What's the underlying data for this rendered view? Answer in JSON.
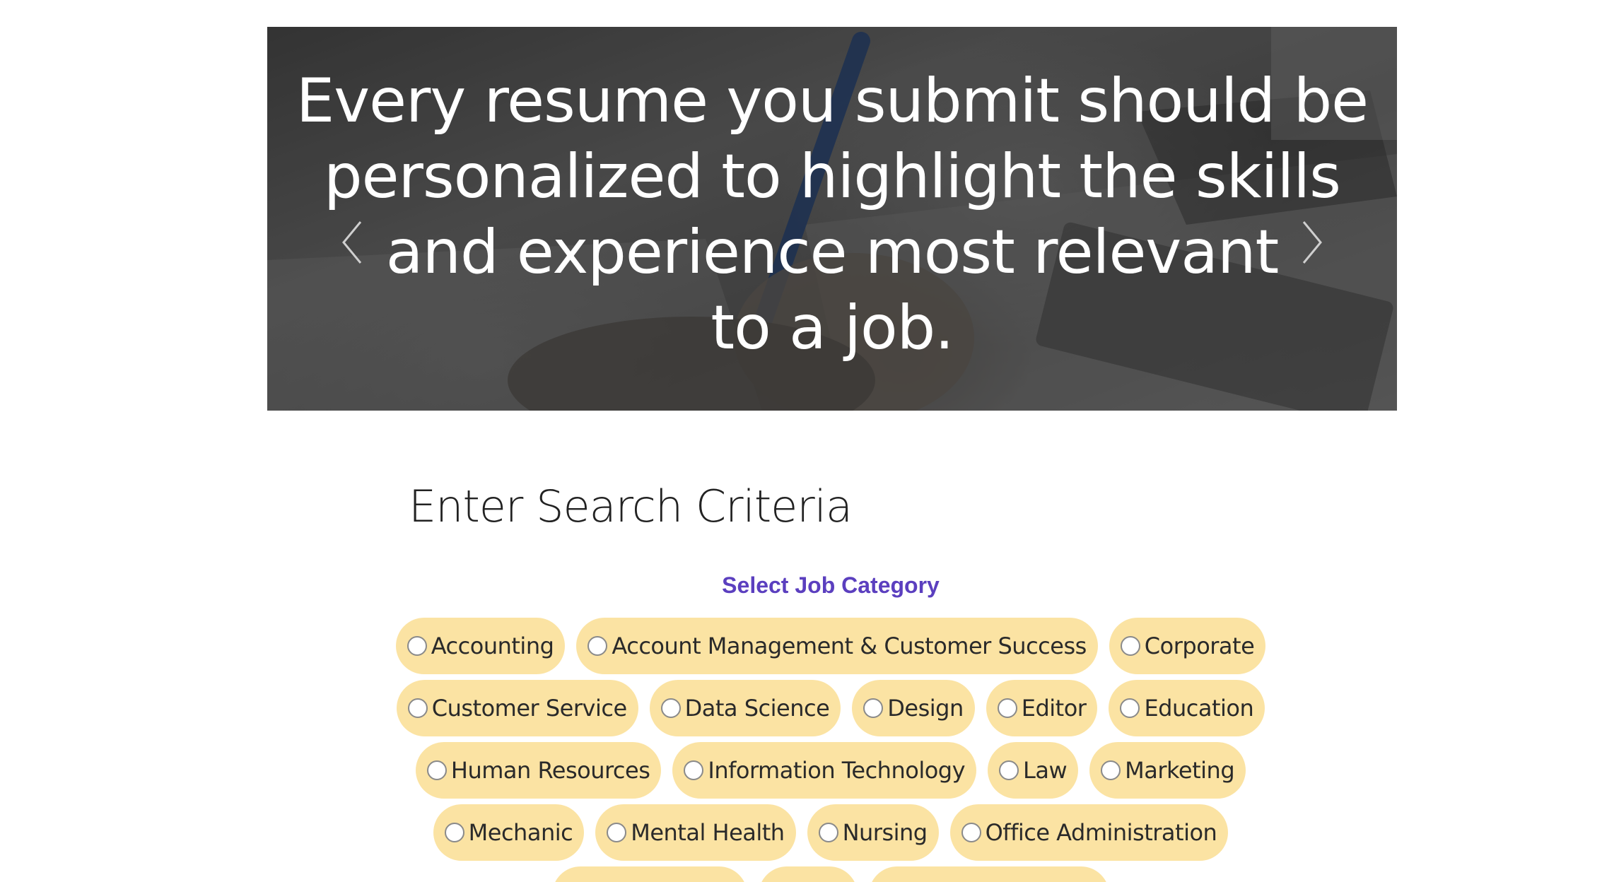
{
  "hero": {
    "lines": [
      "Every resume you submit should be",
      "personalized to highlight the skills",
      "and experience most relevant",
      "to a job."
    ],
    "prev_icon": "chevron-left-icon",
    "next_icon": "chevron-right-icon"
  },
  "search": {
    "title": "Enter Search Criteria",
    "category_heading": "Select Job Category",
    "heading_color": "#5b3fbf",
    "chip_color": "#fbe3a3",
    "rows": [
      [
        "Accounting",
        "Account Management & Customer Success",
        "Corporate"
      ],
      [
        "Customer Service",
        "Data Science",
        "Design",
        "Editor",
        "Education"
      ],
      [
        "Human Resources",
        "Information Technology",
        "Law",
        "Marketing"
      ],
      [
        "Mechanic",
        "Mental Health",
        "Nursing",
        "Office Administration"
      ]
    ]
  }
}
